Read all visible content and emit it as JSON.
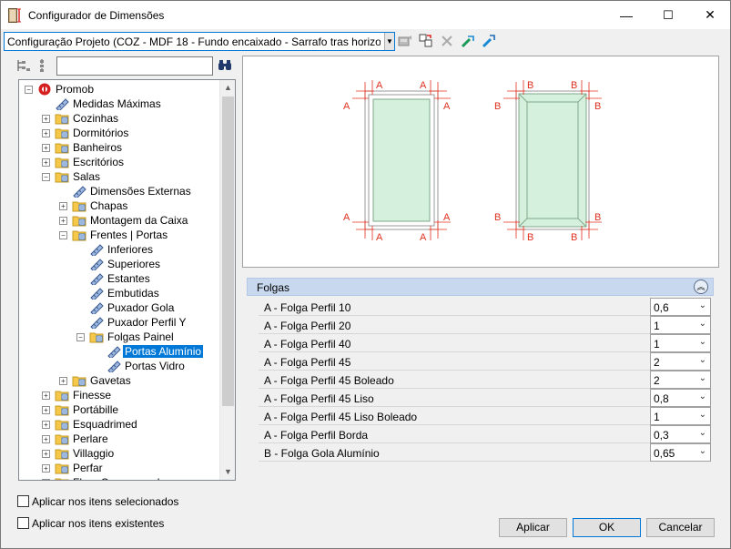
{
  "window": {
    "title": "Configurador de Dimensões",
    "minimize": "—",
    "maximize": "☐",
    "close": "✕"
  },
  "toolbar": {
    "config_value": "Configuração Projeto (COZ - MDF 18 - Fundo encaixado - Sarrafo tras horizontal)"
  },
  "search": {
    "value": "",
    "placeholder": ""
  },
  "tree": {
    "nodes": [
      {
        "label": "Promob",
        "level": 0,
        "type": "root",
        "expander": "-"
      },
      {
        "label": "Medidas Máximas",
        "level": 1,
        "type": "item"
      },
      {
        "label": "Cozinhas",
        "level": 1,
        "type": "folder",
        "expander": "+"
      },
      {
        "label": "Dormitórios",
        "level": 1,
        "type": "folder",
        "expander": "+"
      },
      {
        "label": "Banheiros",
        "level": 1,
        "type": "folder",
        "expander": "+"
      },
      {
        "label": "Escritórios",
        "level": 1,
        "type": "folder",
        "expander": "+"
      },
      {
        "label": "Salas",
        "level": 1,
        "type": "folder",
        "expander": "-"
      },
      {
        "label": "Dimensões Externas",
        "level": 2,
        "type": "item"
      },
      {
        "label": "Chapas",
        "level": 2,
        "type": "folder",
        "expander": "+"
      },
      {
        "label": "Montagem da Caixa",
        "level": 2,
        "type": "folder",
        "expander": "+"
      },
      {
        "label": "Frentes | Portas",
        "level": 2,
        "type": "folder",
        "expander": "-"
      },
      {
        "label": "Inferiores",
        "level": 3,
        "type": "item"
      },
      {
        "label": "Superiores",
        "level": 3,
        "type": "item"
      },
      {
        "label": "Estantes",
        "level": 3,
        "type": "item"
      },
      {
        "label": "Embutidas",
        "level": 3,
        "type": "item"
      },
      {
        "label": "Puxador Gola",
        "level": 3,
        "type": "item"
      },
      {
        "label": "Puxador Perfil Y",
        "level": 3,
        "type": "item"
      },
      {
        "label": "Folgas Painel",
        "level": 3,
        "type": "folder",
        "expander": "-"
      },
      {
        "label": "Portas Alumínio",
        "level": 4,
        "type": "item",
        "selected": true
      },
      {
        "label": "Portas Vidro",
        "level": 4,
        "type": "item"
      },
      {
        "label": "Gavetas",
        "level": 2,
        "type": "folder",
        "expander": "+"
      },
      {
        "label": "Finesse",
        "level": 1,
        "type": "folder",
        "expander": "+"
      },
      {
        "label": "Portábille",
        "level": 1,
        "type": "folder",
        "expander": "+"
      },
      {
        "label": "Esquadrimed",
        "level": 1,
        "type": "folder",
        "expander": "+"
      },
      {
        "label": "Perlare",
        "level": 1,
        "type": "folder",
        "expander": "+"
      },
      {
        "label": "Villaggio",
        "level": 1,
        "type": "folder",
        "expander": "+"
      },
      {
        "label": "Perfar",
        "level": 1,
        "type": "folder",
        "expander": "+"
      },
      {
        "label": "Flora Compensado",
        "level": 1,
        "type": "folder",
        "expander": "+"
      }
    ]
  },
  "preview": {
    "dim_a": "A",
    "dim_b": "B",
    "dim_color": "#e0301e",
    "panel_fill": "#d5f0dc"
  },
  "properties": {
    "section_title": "Folgas",
    "rows": [
      {
        "key": "A - Folga Perfil 10",
        "value": "0,6"
      },
      {
        "key": "A - Folga Perfil 20",
        "value": "1"
      },
      {
        "key": "A - Folga Perfil 40",
        "value": "1"
      },
      {
        "key": "A - Folga Perfil 45",
        "value": "2"
      },
      {
        "key": "A - Folga Perfil 45 Boleado",
        "value": "2"
      },
      {
        "key": "A - Folga Perfil 45 Liso",
        "value": "0,8"
      },
      {
        "key": "A - Folga Perfil 45 Liso Boleado",
        "value": "1"
      },
      {
        "key": "A - Folga Perfil Borda",
        "value": "0,3"
      },
      {
        "key": "B - Folga Gola Alumínio",
        "value": "0,65"
      }
    ]
  },
  "options": {
    "apply_selected": "Aplicar nos itens selecionados",
    "apply_existing": "Aplicar nos itens existentes"
  },
  "buttons": {
    "apply": "Aplicar",
    "ok": "OK",
    "cancel": "Cancelar"
  }
}
